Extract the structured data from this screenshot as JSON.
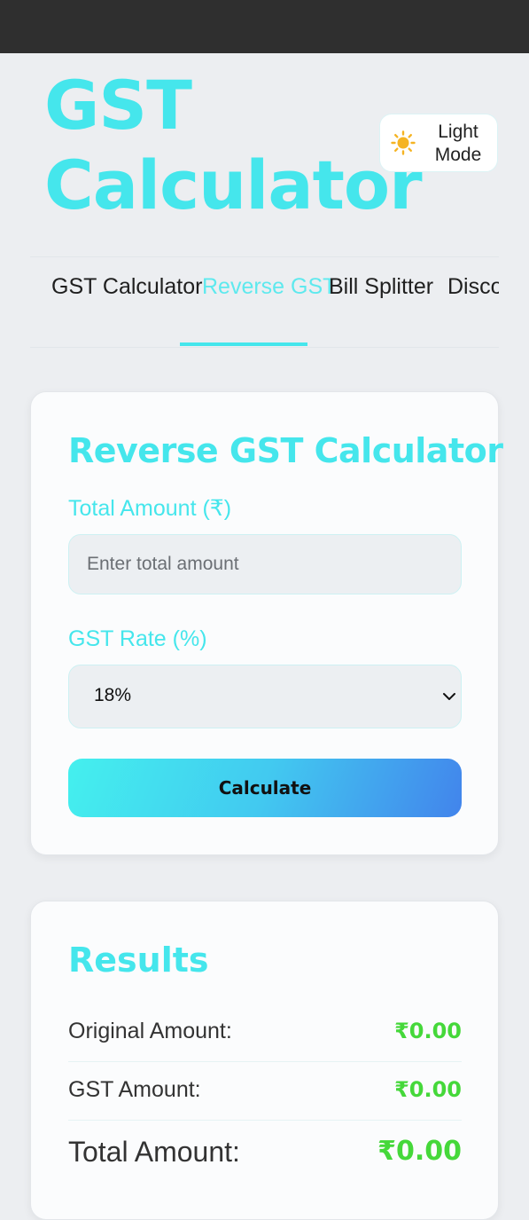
{
  "header": {
    "title": "GST Calculator",
    "theme_toggle": {
      "icon": "sun-icon",
      "label": "Light Mode"
    }
  },
  "tabs": [
    {
      "label": "GST Calculator",
      "active": false
    },
    {
      "label": "Reverse GST",
      "active": true
    },
    {
      "label": "Bill Splitter",
      "active": false
    },
    {
      "label": "Discount Calculator",
      "active": false
    }
  ],
  "calculator": {
    "title": "Reverse GST Calculator",
    "amount_label": "Total Amount (₹)",
    "amount_placeholder": "Enter total amount",
    "amount_value": "",
    "rate_label": "GST Rate (%)",
    "rate_selected": "18%",
    "button_label": "Calculate"
  },
  "results": {
    "title": "Results",
    "rows": [
      {
        "label": "Original Amount:",
        "value": "₹0.00"
      },
      {
        "label": "GST Amount:",
        "value": "₹0.00"
      },
      {
        "label": "Total Amount:",
        "value": "₹0.00"
      }
    ]
  },
  "colors": {
    "accent": "#45e6ec",
    "value_green": "#45d83a",
    "topbar": "#2f2f2f"
  }
}
